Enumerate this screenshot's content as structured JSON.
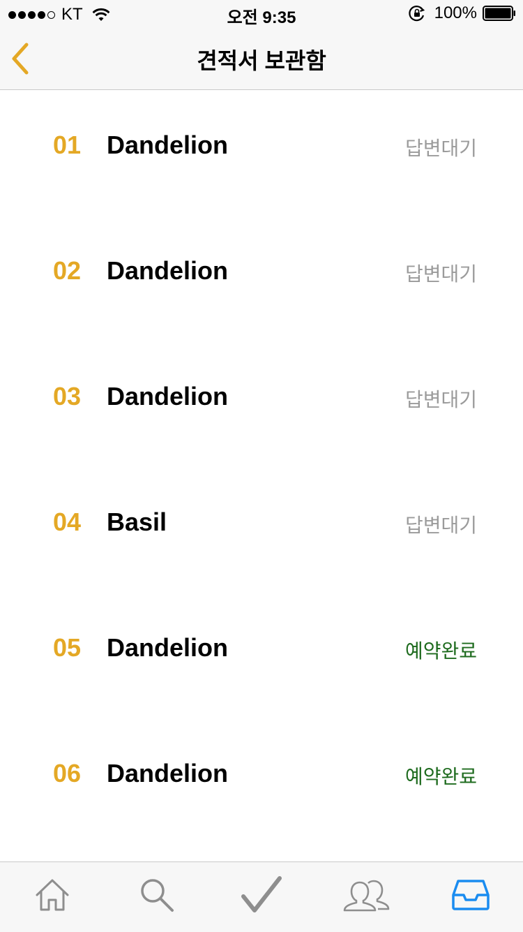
{
  "status_bar": {
    "carrier": "KT",
    "time": "오전 9:35",
    "battery": "100%"
  },
  "nav": {
    "title": "견적서 보관함",
    "back_icon": "chevron-left-icon",
    "accent_color": "#e4a825"
  },
  "quotes": [
    {
      "num": "01",
      "name": "Dandelion",
      "status": "답변대기"
    },
    {
      "num": "02",
      "name": "Dandelion",
      "status": "답변대기"
    },
    {
      "num": "03",
      "name": "Dandelion",
      "status": "답변대기"
    },
    {
      "num": "04",
      "name": "Basil",
      "status": "답변대기"
    },
    {
      "num": "05",
      "name": "Dandelion",
      "status": "예약완료"
    },
    {
      "num": "06",
      "name": "Dandelion",
      "status": "예약완료"
    }
  ],
  "colors": {
    "number": "#e4a825",
    "pending": "#9b9b9b",
    "completed": "#1e6b1e",
    "tab_active": "#1a8cf0",
    "tab_inactive": "#8e8e8e"
  },
  "tabs": [
    {
      "icon": "home-icon",
      "active": false
    },
    {
      "icon": "search-icon",
      "active": false
    },
    {
      "icon": "checkmark-icon",
      "active": false
    },
    {
      "icon": "people-icon",
      "active": false
    },
    {
      "icon": "inbox-icon",
      "active": true
    }
  ]
}
